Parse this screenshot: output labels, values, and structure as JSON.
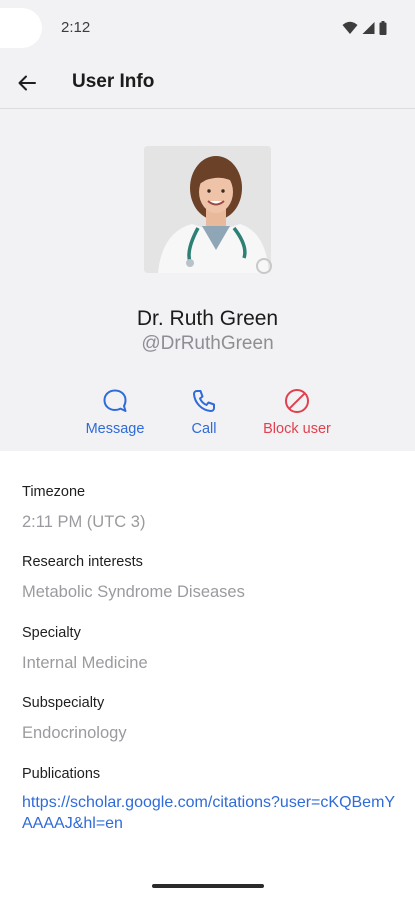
{
  "status_bar": {
    "time": "2:12"
  },
  "app_bar": {
    "title": "User Info"
  },
  "profile": {
    "name": "Dr. Ruth Green",
    "handle": "@DrRuthGreen"
  },
  "actions": [
    {
      "label": "Message",
      "icon": "message-bubble-icon",
      "color": "#2f6bd9"
    },
    {
      "label": "Call",
      "icon": "phone-icon",
      "color": "#2f6bd9"
    },
    {
      "label": "Block user",
      "icon": "block-icon",
      "color": "#e0414f"
    }
  ],
  "fields": [
    {
      "label": "Timezone",
      "value": "2:11 PM (UTC 3)"
    },
    {
      "label": "Research interests",
      "value": "Metabolic Syndrome Diseases"
    },
    {
      "label": "Specialty",
      "value": "Internal Medicine"
    },
    {
      "label": "Subspecialty",
      "value": "Endocrinology"
    },
    {
      "label": "Publications",
      "value": "https://scholar.google.com/citations?user=cKQBemYAAAAJ&hl=en"
    }
  ],
  "colors": {
    "accent": "#2f6bd9",
    "danger": "#e0414f",
    "header_bg": "#f2f2f4",
    "muted": "#9b9b9f"
  }
}
